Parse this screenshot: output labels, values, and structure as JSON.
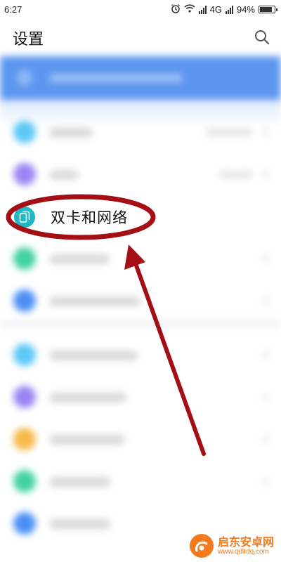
{
  "status_bar": {
    "time": "6:27",
    "network": "4G",
    "battery_percent": "94%",
    "battery_level": 0.94,
    "icons": [
      "alarm-icon",
      "wifi-icon",
      "signal-icon",
      "signal-icon",
      "battery-icon"
    ]
  },
  "header": {
    "title": "设置",
    "search_icon": "search-icon"
  },
  "highlighted_item": {
    "label": "双卡和网络",
    "icon": "dual-sim-icon",
    "icon_color": "#1fb8c4"
  },
  "annotation": {
    "ellipse_color": "#a40f16",
    "arrow_color": "#a40f16"
  },
  "watermark": {
    "title": "启东安卓网",
    "url": "www.qdltdq.com",
    "color": "#f37b1d"
  }
}
